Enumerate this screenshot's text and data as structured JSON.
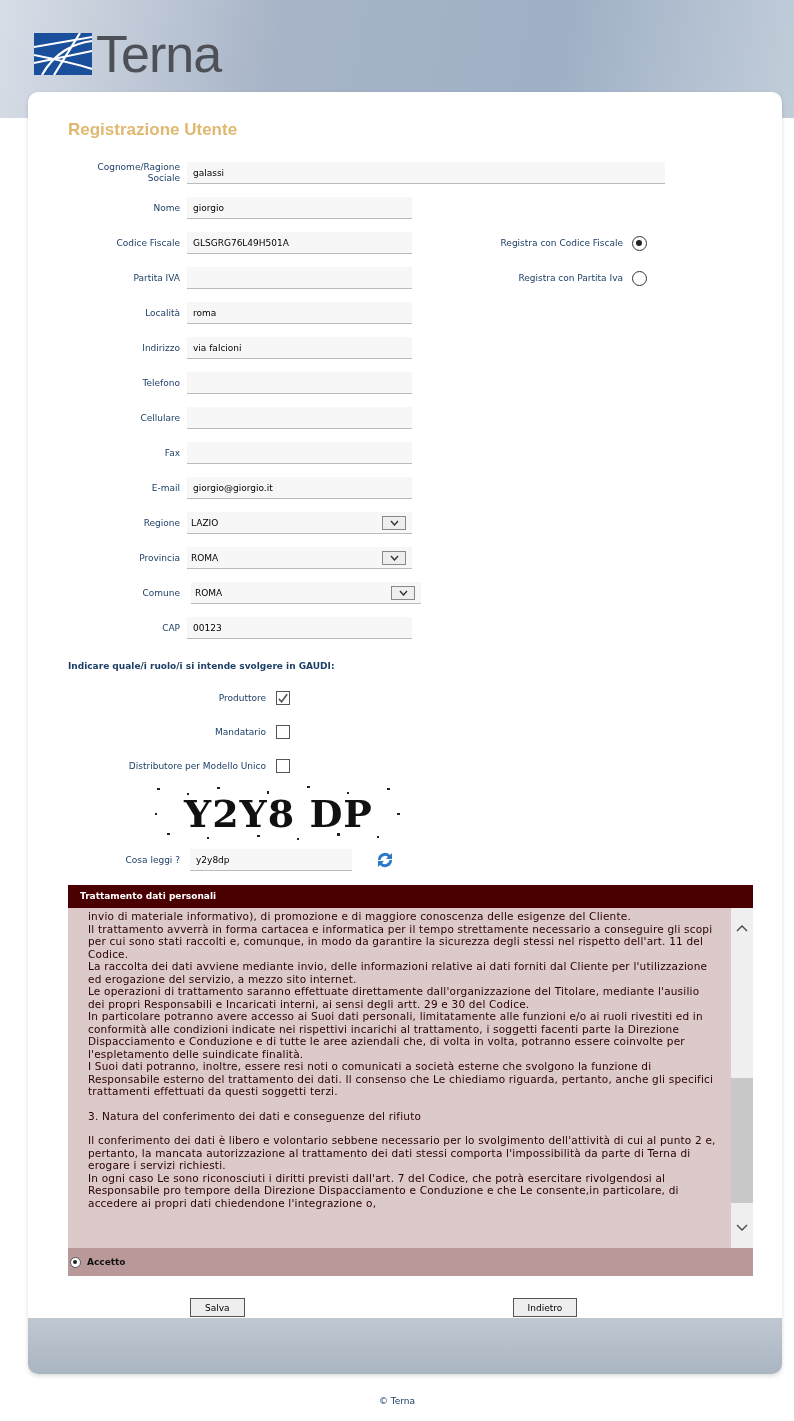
{
  "header": {
    "logo_text": "Terna"
  },
  "title": "Registrazione Utente",
  "fields": [
    {
      "label": "Cognome/Ragione Sociale",
      "value": "galassi",
      "kind": "wide"
    },
    {
      "label": "Nome",
      "value": "giorgio",
      "kind": "text"
    },
    {
      "label": "Codice Fiscale",
      "value": "GLSGRG76L49H501A",
      "kind": "text",
      "option": {
        "label": "Registra con Codice Fiscale",
        "selected": true
      }
    },
    {
      "label": "Partita IVA",
      "kind": "text",
      "option": {
        "label": "Registra con Partita Iva",
        "selected": false
      }
    },
    {
      "label": "Località",
      "value": "roma",
      "kind": "text"
    },
    {
      "label": "Indirizzo",
      "value": "via falcioni",
      "kind": "text"
    },
    {
      "label": "Telefono",
      "kind": "text"
    },
    {
      "label": "Cellulare",
      "kind": "text"
    },
    {
      "label": "Fax",
      "kind": "text"
    },
    {
      "label": "E-mail",
      "value": "giorgio@giorgio.it",
      "kind": "text"
    },
    {
      "label": "Regione",
      "value": "LAZIO",
      "kind": "select"
    },
    {
      "label": "Provincia",
      "value": "ROMA",
      "kind": "select"
    },
    {
      "label": "Comune",
      "value": "ROMA",
      "kind": "select"
    },
    {
      "label": "CAP",
      "value": "00123",
      "kind": "text"
    }
  ],
  "roles_title": "Indicare quale/i ruolo/i si intende svolgere in GAUDI:",
  "roles": [
    {
      "label": "Produttore",
      "checked": true
    },
    {
      "label": "Mandatario",
      "checked": false
    },
    {
      "label": "Distributore per Modello Unico",
      "checked": false
    }
  ],
  "captcha": {
    "image_text": "Y2Y8 DP",
    "label": "Cosa leggi ?",
    "value": "y2y8dp"
  },
  "privacy": {
    "title": "Trattamento dati personali",
    "paragraphs": [
      {
        "kind": "text",
        "text": "invio di materiale informativo), di promozione e di maggiore conoscenza delle esigenze del Cliente."
      },
      {
        "kind": "text",
        "text": "Il trattamento avverrà in forma cartacea e informatica per il tempo strettamente necessario a conseguire gli scopi per cui sono stati raccolti e, comunque, in modo da garantire la sicurezza degli stessi nel rispetto dell'art. 11 del Codice."
      },
      {
        "kind": "text",
        "text": "La raccolta dei dati avviene mediante invio, delle informazioni relative ai dati forniti dal Cliente per l'utilizzazione ed erogazione del servizio, a mezzo sito internet."
      },
      {
        "kind": "text",
        "text": "Le operazioni di trattamento saranno effettuate direttamente dall'organizzazione del Titolare, mediante l'ausilio dei propri Responsabili e Incaricati interni, ai sensi degli artt. 29 e 30 del Codice."
      },
      {
        "kind": "text",
        "text": "In particolare potranno avere accesso ai Suoi dati personali, limitatamente alle funzioni e/o ai ruoli rivestiti ed in conformità alle condizioni indicate nei rispettivi incarichi al trattamento, i soggetti facenti parte la Direzione Dispacciamento e Conduzione e di tutte le aree aziendali che, di volta in volta, potranno essere coinvolte per l'espletamento delle suindicate finalità."
      },
      {
        "kind": "text",
        "text": "I Suoi dati potranno, inoltre, essere resi noti o comunicati a società esterne che svolgono la funzione di Responsabile esterno del trattamento dei dati. Il consenso che Le chiediamo riguarda, pertanto, anche gli specifici trattamenti effettuati da questi soggetti terzi."
      },
      {
        "kind": "heading",
        "text": "3. Natura del conferimento dei dati e conseguenze del rifiuto"
      },
      {
        "kind": "text",
        "text": "Il conferimento dei dati è libero e volontario sebbene necessario per lo svolgimento dell'attività di cui al punto 2 e, pertanto, la mancata autorizzazione al trattamento dei dati stessi comporta l'impossibilità da parte di Terna di erogare i servizi richiesti."
      },
      {
        "kind": "text",
        "text": "In ogni caso Le sono riconosciuti i diritti previsti dall'art. 7 del Codice, che potrà esercitare rivolgendosi al Responsabile pro tempore della Direzione Dispacciamento e Conduzione e che Le consente,in particolare, di accedere ai propri dati chiedendone l'integrazione o,"
      }
    ],
    "accept": {
      "label": "Accetto",
      "selected": true
    }
  },
  "buttons": [
    "Salva",
    "Indietro"
  ],
  "footer": "© Terna"
}
